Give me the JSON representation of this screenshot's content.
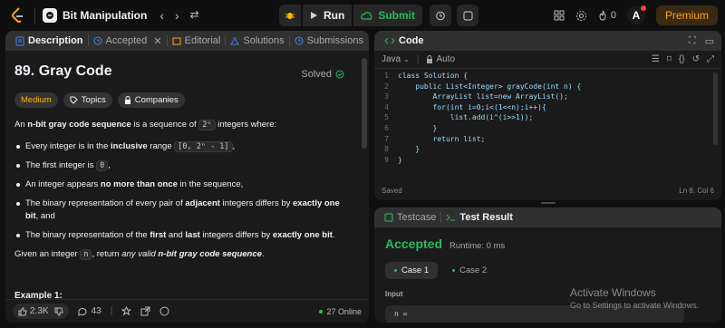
{
  "topbar": {
    "title": "Bit Manipulation",
    "run_label": "Run",
    "submit_label": "Submit",
    "fire_count": "0",
    "avatar_letter": "A",
    "premium_label": "Premium"
  },
  "left_panel": {
    "tabs": [
      {
        "label": "Description"
      },
      {
        "label": "Accepted"
      },
      {
        "label": "Editorial"
      },
      {
        "label": "Solutions"
      },
      {
        "label": "Submissions"
      }
    ],
    "title": "89. Gray Code",
    "solved_label": "Solved",
    "tags": [
      "Medium",
      "Topics",
      "Companies"
    ],
    "intro_pre": "An ",
    "intro_bold": "n-bit gray code sequence",
    "intro_mid": " is a sequence of ",
    "intro_code": "2ⁿ",
    "intro_post": " integers where:",
    "bullets": [
      {
        "pre": "Every integer is in the ",
        "bold": "inclusive",
        "mid": " range ",
        "code": "[0, 2ⁿ - 1]",
        "post": ","
      },
      {
        "pre": "The first integer is ",
        "code": "0",
        "post": ","
      },
      {
        "pre": "An integer appears ",
        "bold": "no more than once",
        "post": " in the sequence,"
      },
      {
        "pre": "The binary representation of every pair of ",
        "bold": "adjacent",
        "mid": " integers differs by ",
        "bold2": "exactly one bit",
        "post": ", and"
      },
      {
        "pre": "The binary representation of the ",
        "bold": "first",
        "mid": " and ",
        "bold2": "last",
        "mid2": " integers differs by ",
        "bold3": "exactly one bit",
        "post": "."
      }
    ],
    "given_pre": "Given an integer ",
    "given_code": "n",
    "given_mid": ", return ",
    "given_italic": "any valid ",
    "given_bold_italic": "n-bit gray code sequence",
    "given_post": ".",
    "example_title": "Example 1:",
    "footer": {
      "likes": "2.3K",
      "comments": "43",
      "online": "27 Online"
    }
  },
  "code_panel": {
    "title": "Code",
    "language": "Java",
    "auto_label": "Auto",
    "lines": [
      "class Solution {",
      "    public List<Integer> grayCode(int n) {",
      "        ArrayList list=new ArrayList();",
      "        for(int i=0;i<(1<<n);i++){",
      "            list.add(i^(i>>1));",
      "        }",
      "        return list;",
      "    }",
      "}"
    ],
    "status_left": "Saved",
    "status_right": "Ln 8, Col 6"
  },
  "test_panel": {
    "tabs": [
      {
        "label": "Testcase"
      },
      {
        "label": "Test Result"
      }
    ],
    "result": "Accepted",
    "runtime": "Runtime: 0 ms",
    "cases": [
      "Case 1",
      "Case 2"
    ],
    "input_label": "Input",
    "input_value": "n ="
  },
  "os_overlay": {
    "line1": "Activate Windows",
    "line2": "Go to Settings to activate Windows."
  },
  "colors": {
    "accent_orange": "#ffa116",
    "success_green": "#2cbb5d",
    "medium_yellow": "#ffb800",
    "link_blue": "#3b82f6"
  }
}
